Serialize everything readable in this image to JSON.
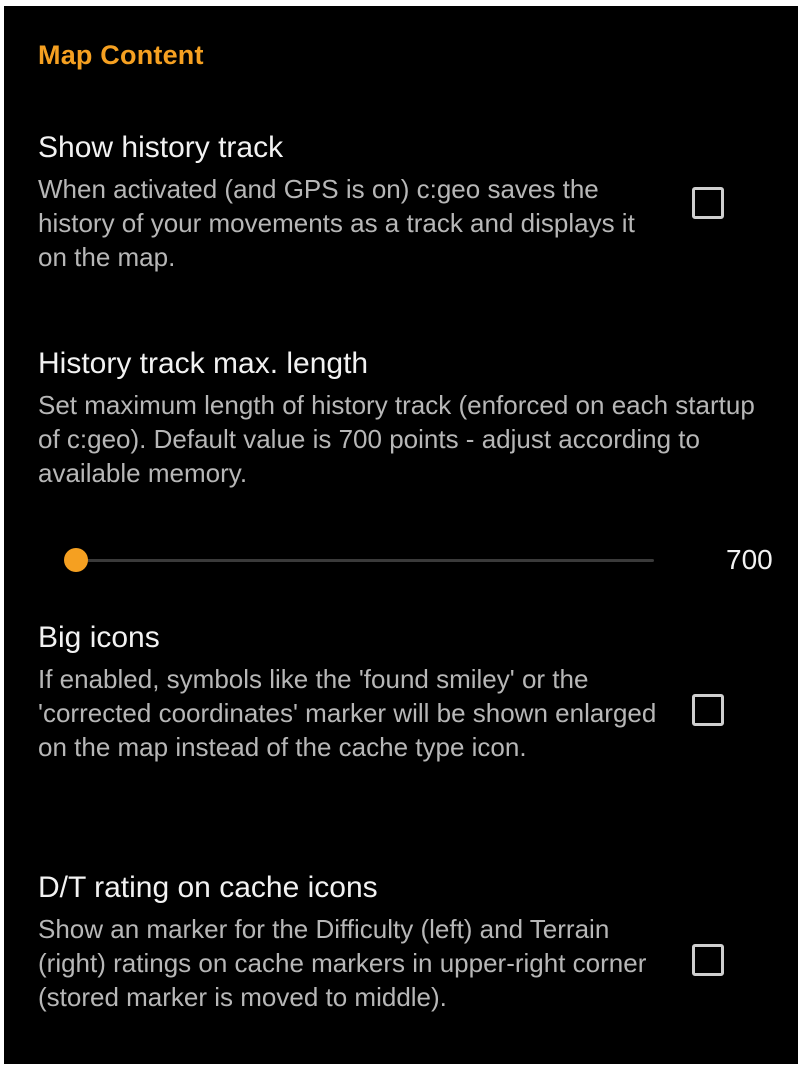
{
  "section": {
    "header": "Map Content"
  },
  "prefs": [
    {
      "title": "Show history track",
      "summary": "When activated (and GPS is on) c:geo saves the history of your movements as a track and displays it on the map.",
      "checked": false
    },
    {
      "title": "History track max. length",
      "summary": "Set maximum length of history track (enforced on each startup of c:geo). Default value is 700 points - adjust according to available memory.",
      "slider": {
        "value": "700",
        "fraction": 0.0
      }
    },
    {
      "title": "Big icons",
      "summary": "If enabled, symbols like the 'found smiley' or the 'corrected coordinates' marker will be shown enlarged on the map instead of the cache type icon.",
      "checked": false
    },
    {
      "title": "D/T rating on cache icons",
      "summary": "Show an marker for the Difficulty (left) and Terrain (right) ratings on cache markers in upper-right corner (stored marker is moved to middle).",
      "checked": false
    }
  ],
  "colors": {
    "background": "#000000",
    "accent": "#f5a021",
    "title_text": "#f2f2f2",
    "summary_text": "#b7b7b7"
  }
}
